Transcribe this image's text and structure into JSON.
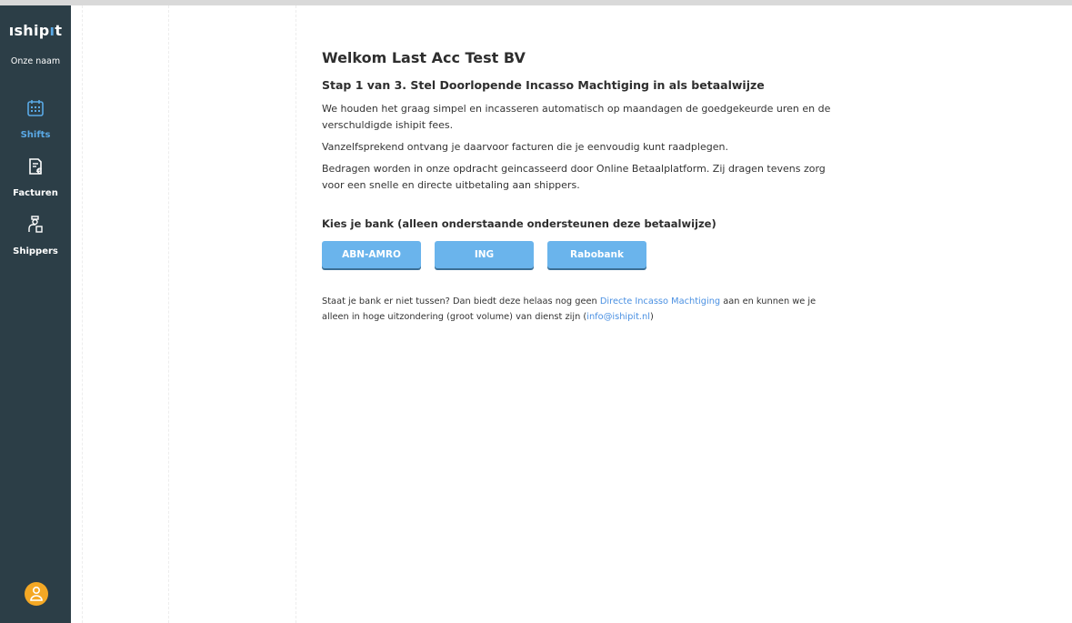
{
  "sidebar": {
    "logo_prefix": "ıship",
    "logo_accent": "ı",
    "logo_suffix": "t",
    "company_name": "Onze naam",
    "items": [
      {
        "label": "Shifts",
        "icon": "calendar-icon",
        "active": true
      },
      {
        "label": "Facturen",
        "icon": "invoice-icon",
        "active": false
      },
      {
        "label": "Shippers",
        "icon": "shippers-icon",
        "active": false
      }
    ],
    "avatar_icon": "user-icon"
  },
  "main": {
    "title": "Welkom Last Acc Test BV",
    "step": "Stap 1 van 3. Stel Doorlopende Incasso Machtiging in als betaalwijze",
    "paragraphs": [
      "We houden het graag simpel en incasseren automatisch op maandagen de goedgekeurde uren en de verschuldigde ishipit fees.",
      "Vanzelfsprekend ontvang je daarvoor facturen die je eenvoudig kunt raadplegen.",
      "Bedragen worden in onze opdracht geincasseerd door Online Betaalplatform. Zij dragen tevens zorg voor een snelle en directe uitbetaling aan shippers."
    ],
    "bank_heading": "Kies je bank (alleen onderstaande ondersteunen deze betaalwijze)",
    "banks": [
      "ABN-AMRO",
      "ING",
      "Rabobank"
    ],
    "footer": {
      "text_before": "Staat je bank er niet tussen? Dan biedt deze helaas nog geen ",
      "link_mandate": "Directe Incasso Machtiging",
      "text_middle": " aan en kunnen we je alleen in hoge uitzondering (groot volume) van dienst zijn (",
      "link_email": "info@ishipit.nl",
      "text_after": ")"
    }
  },
  "colors": {
    "sidebar_bg": "#2c3e47",
    "accent": "#5aa9e6",
    "button_bg": "#6ab4ec",
    "avatar_bg": "#f4a825",
    "link": "#4a90e2"
  }
}
